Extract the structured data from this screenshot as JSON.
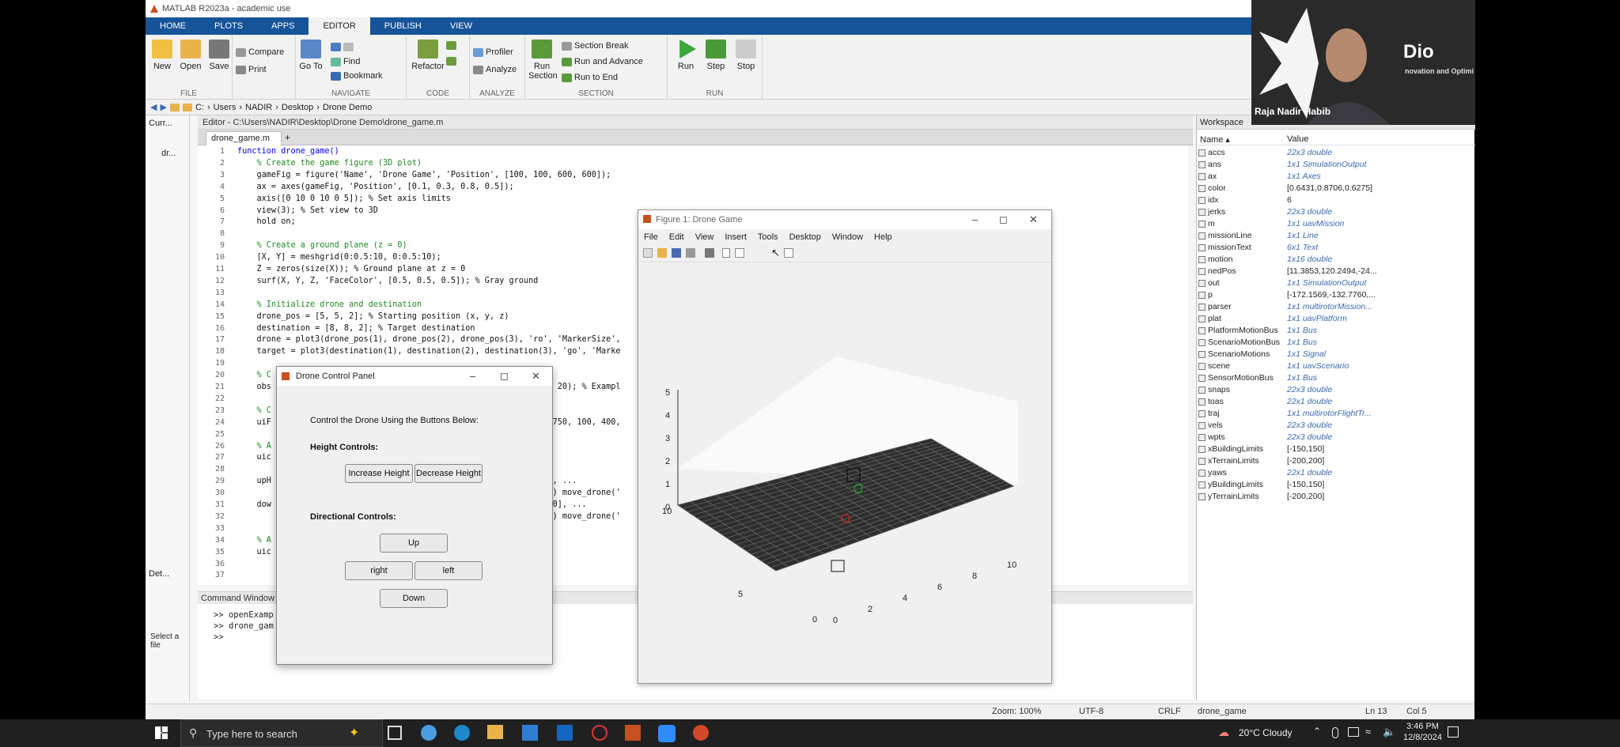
{
  "app": {
    "title": "MATLAB R2023a - academic use"
  },
  "ribbon": {
    "tabs": [
      "HOME",
      "PLOTS",
      "APPS",
      "EDITOR",
      "PUBLISH",
      "VIEW"
    ],
    "active_tab": "EDITOR",
    "file": {
      "new": "New",
      "open": "Open",
      "save": "Save",
      "compare": "Compare",
      "print": "Print",
      "label": "FILE"
    },
    "navigate": {
      "goto": "Go To",
      "find": "Find",
      "bookmark": "Bookmark",
      "label": "NAVIGATE"
    },
    "code": {
      "refactor": "Refactor",
      "label": "CODE"
    },
    "analyze": {
      "profiler": "Profiler",
      "analyze": "Analyze",
      "label": "ANALYZE"
    },
    "section": {
      "run_section": "Run Section",
      "section_break": "Section Break",
      "run_advance": "Run and Advance",
      "run_to_end": "Run to End",
      "label": "SECTION"
    },
    "run": {
      "run": "Run",
      "step": "Step",
      "stop": "Stop",
      "label": "RUN"
    }
  },
  "address": {
    "parts": [
      "C:",
      "Users",
      "NADIR",
      "Desktop",
      "Drone Demo"
    ]
  },
  "left_panel": {
    "title": "Curr...",
    "item": "dr...",
    "details": "Det...",
    "hint": "Select a file"
  },
  "editor": {
    "header": "Editor - C:\\Users\\NADIR\\Desktop\\Drone Demo\\drone_game.m",
    "file_tab": "drone_game.m",
    "lines": [
      {
        "n": "1",
        "t": "function drone_game()",
        "k": "kw"
      },
      {
        "n": "2",
        "t": "    % Create the game figure (3D plot)",
        "k": "cm"
      },
      {
        "n": "3",
        "t": "    gameFig = figure('Name', 'Drone Game', 'Position', [100, 100, 600, 600]);",
        "k": ""
      },
      {
        "n": "4",
        "t": "    ax = axes(gameFig, 'Position', [0.1, 0.3, 0.8, 0.5]);",
        "k": ""
      },
      {
        "n": "5",
        "t": "    axis([0 10 0 10 0 5]); % Set axis limits",
        "k": ""
      },
      {
        "n": "6",
        "t": "    view(3); % Set view to 3D",
        "k": ""
      },
      {
        "n": "7",
        "t": "    hold on;",
        "k": ""
      },
      {
        "n": "8",
        "t": "",
        "k": ""
      },
      {
        "n": "9",
        "t": "    % Create a ground plane (z = 0)",
        "k": "cm"
      },
      {
        "n": "10",
        "t": "    [X, Y] = meshgrid(0:0.5:10, 0:0.5:10);",
        "k": ""
      },
      {
        "n": "11",
        "t": "    Z = zeros(size(X)); % Ground plane at z = 0",
        "k": ""
      },
      {
        "n": "12",
        "t": "    surf(X, Y, Z, 'FaceColor', [0.5, 0.5, 0.5]); % Gray ground",
        "k": ""
      },
      {
        "n": "13",
        "t": "",
        "k": ""
      },
      {
        "n": "14",
        "t": "    % Initialize drone and destination",
        "k": "cm"
      },
      {
        "n": "15",
        "t": "    drone_pos = [5, 5, 2]; % Starting position (x, y, z)",
        "k": ""
      },
      {
        "n": "16",
        "t": "    destination = [8, 8, 2]; % Target destination",
        "k": ""
      },
      {
        "n": "17",
        "t": "    drone = plot3(drone_pos(1), drone_pos(2), drone_pos(3), 'ro', 'MarkerSize',",
        "k": ""
      },
      {
        "n": "18",
        "t": "    target = plot3(destination(1), destination(2), destination(3), 'go', 'Marke",
        "k": ""
      },
      {
        "n": "19",
        "t": "",
        "k": ""
      },
      {
        "n": "20",
        "t": "    % C",
        "k": "cm"
      },
      {
        "n": "21",
        "t": "    obs                                                       e', 20); % Exampl",
        "k": ""
      },
      {
        "n": "22",
        "t": "",
        "k": ""
      },
      {
        "n": "23",
        "t": "    % C",
        "k": "cm"
      },
      {
        "n": "24",
        "t": "    uiF                                                       , [750, 100, 400,",
        "k": ""
      },
      {
        "n": "25",
        "t": "",
        "k": ""
      },
      {
        "n": "26",
        "t": "    % A",
        "k": "cm"
      },
      {
        "n": "27",
        "t": "    uic",
        "k": ""
      },
      {
        "n": "28",
        "t": "",
        "k": ""
      },
      {
        "n": "29",
        "t": "    upH                                                       30], ...",
        "k": ""
      },
      {
        "n": "30",
        "t": "                                                              ent) move_drone('",
        "k": ""
      },
      {
        "n": "31",
        "t": "    dow                                                       , 30], ...",
        "k": ""
      },
      {
        "n": "32",
        "t": "                                                              ent) move_drone('",
        "k": ""
      },
      {
        "n": "33",
        "t": "",
        "k": ""
      },
      {
        "n": "34",
        "t": "    % A",
        "k": "cm"
      },
      {
        "n": "35",
        "t": "    uic",
        "k": ""
      },
      {
        "n": "36",
        "t": "                                                              5",
        "k": ""
      },
      {
        "n": "37",
        "t": "",
        "k": ""
      }
    ]
  },
  "command_window": {
    "title": "Command Window",
    "lines": [
      ">> openExamp                                         le')",
      ">> drone_gam",
      ">>"
    ]
  },
  "workspace": {
    "title": "Workspace",
    "col_name": "Name ▴",
    "col_value": "Value",
    "rows": [
      {
        "name": "accs",
        "value": "22x3 double",
        "italic": true
      },
      {
        "name": "ans",
        "value": "1x1 SimulationOutput",
        "italic": true
      },
      {
        "name": "ax",
        "value": "1x1 Axes",
        "italic": true
      },
      {
        "name": "color",
        "value": "[0.6431,0.8706,0.6275]",
        "italic": false
      },
      {
        "name": "idx",
        "value": "6",
        "italic": false
      },
      {
        "name": "jerks",
        "value": "22x3 double",
        "italic": true
      },
      {
        "name": "m",
        "value": "1x1 uavMission",
        "italic": true
      },
      {
        "name": "missionLine",
        "value": "1x1 Line",
        "italic": true
      },
      {
        "name": "missionText",
        "value": "6x1 Text",
        "italic": true
      },
      {
        "name": "motion",
        "value": "1x16 double",
        "italic": true
      },
      {
        "name": "nedPos",
        "value": "[11.3853,120.2494,-24...",
        "italic": false
      },
      {
        "name": "out",
        "value": "1x1 SimulationOutput",
        "italic": true
      },
      {
        "name": "p",
        "value": "[-172.1569,-132.7760,...",
        "italic": false
      },
      {
        "name": "parser",
        "value": "1x1 multirotorMission...",
        "italic": true
      },
      {
        "name": "plat",
        "value": "1x1 uavPlatform",
        "italic": true
      },
      {
        "name": "PlatformMotionBus",
        "value": "1x1 Bus",
        "italic": true
      },
      {
        "name": "ScenarioMotionBus",
        "value": "1x1 Bus",
        "italic": true
      },
      {
        "name": "ScenarioMotions",
        "value": "1x1 Signal",
        "italic": true
      },
      {
        "name": "scene",
        "value": "1x1 uavScenario",
        "italic": true
      },
      {
        "name": "SensorMotionBus",
        "value": "1x1 Bus",
        "italic": true
      },
      {
        "name": "snaps",
        "value": "22x3 double",
        "italic": true
      },
      {
        "name": "toas",
        "value": "22x1 double",
        "italic": true
      },
      {
        "name": "traj",
        "value": "1x1 multirotorFlightTr...",
        "italic": true
      },
      {
        "name": "vels",
        "value": "22x3 double",
        "italic": true
      },
      {
        "name": "wpts",
        "value": "22x3 double",
        "italic": true
      },
      {
        "name": "xBuildingLimits",
        "value": "[-150,150]",
        "italic": false
      },
      {
        "name": "xTerrainLimits",
        "value": "[-200,200]",
        "italic": false
      },
      {
        "name": "yaws",
        "value": "22x1 double",
        "italic": true
      },
      {
        "name": "yBuildingLimits",
        "value": "[-150,150]",
        "italic": false
      },
      {
        "name": "yTerrainLimits",
        "value": "[-200,200]",
        "italic": false
      }
    ]
  },
  "figure": {
    "title": "Figure 1: Drone Game",
    "menu": [
      "File",
      "Edit",
      "View",
      "Insert",
      "Tools",
      "Desktop",
      "Window",
      "Help"
    ],
    "z_ticks": [
      "5",
      "4",
      "3",
      "2",
      "1",
      "0"
    ],
    "y_ticks": [
      "10",
      "5",
      "0"
    ],
    "x_ticks": [
      "0",
      "2",
      "4",
      "6",
      "8",
      "10"
    ]
  },
  "dialog": {
    "title": "Drone Control Panel",
    "instruction": "Control the Drone Using the Buttons Below:",
    "height_label": "Height Controls:",
    "increase": "Increase Height",
    "decrease": "Decrease Height",
    "dir_label": "Directional Controls:",
    "up": "Up",
    "right": "right",
    "left": "left",
    "down": "Down"
  },
  "status": {
    "zoom": "Zoom: 100%",
    "encoding": "UTF-8",
    "eol": "CRLF",
    "file": "drone_game",
    "ln": "Ln  13",
    "col": "Col  5"
  },
  "webcam": {
    "name": "Raja Nadir Habib",
    "brand": "Dio",
    "tagline": "novation and Optimi"
  },
  "taskbar": {
    "search": "Type here to search",
    "weather": "20°C  Cloudy",
    "time": "3:46 PM",
    "date": "12/8/2024"
  }
}
